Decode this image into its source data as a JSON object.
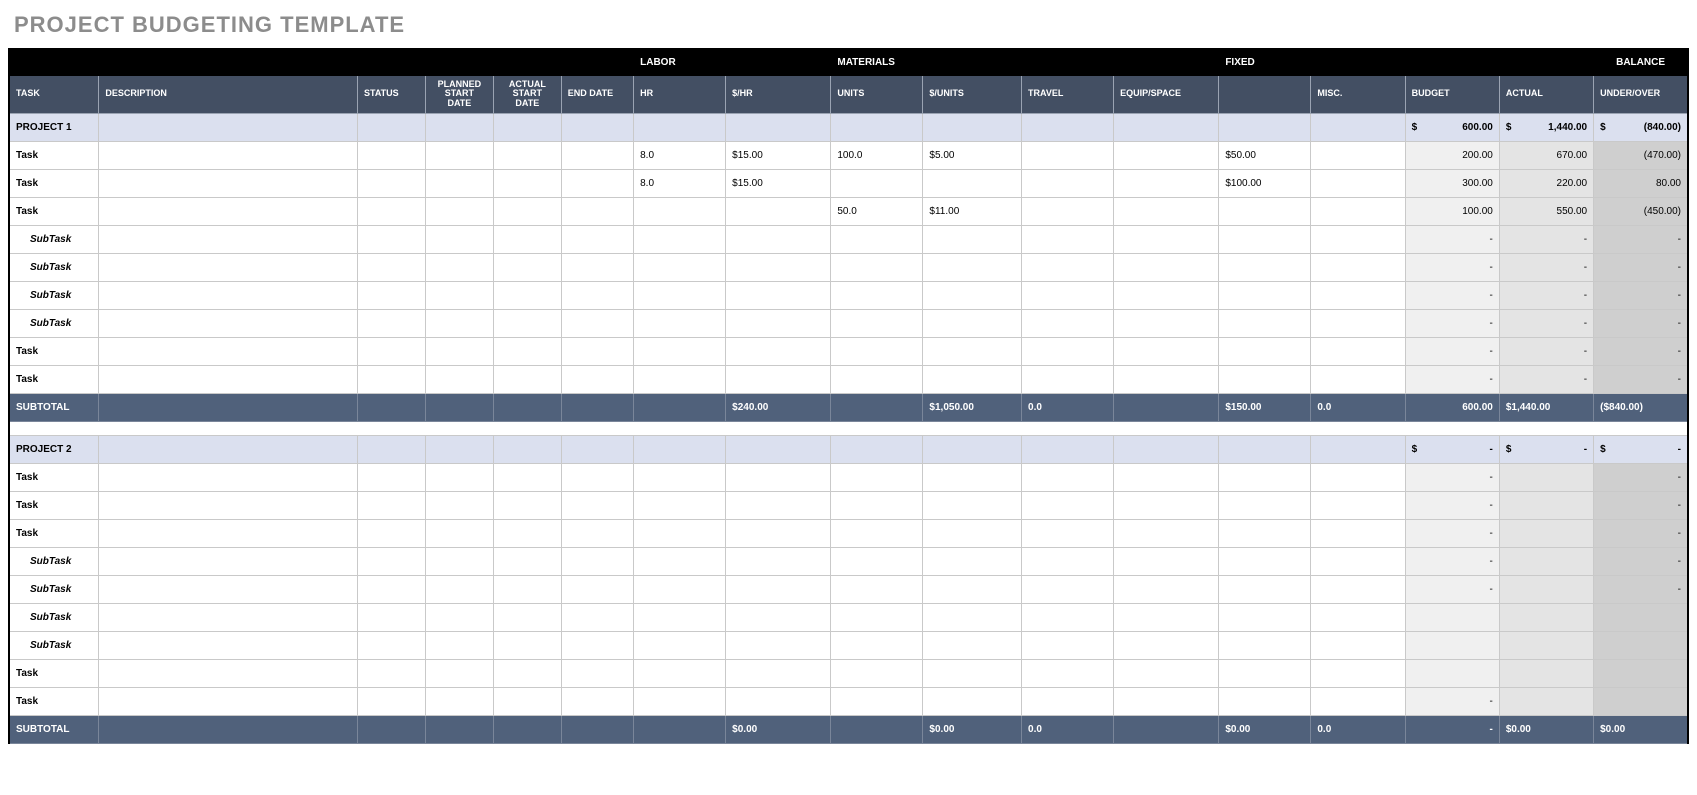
{
  "title": "PROJECT BUDGETING TEMPLATE",
  "categories": {
    "labor": "LABOR",
    "materials": "MATERIALS",
    "fixed": "FIXED",
    "balance": "BALANCE"
  },
  "headers": {
    "task": "TASK",
    "description": "DESCRIPTION",
    "status": "STATUS",
    "planned_start": "PLANNED START DATE",
    "actual_start": "ACTUAL START DATE",
    "end_date": "END DATE",
    "hr": "HR",
    "dollar_hr": "$/HR",
    "units": "UNITS",
    "dollar_units": "$/UNITS",
    "travel": "TRAVEL",
    "equip": "EQUIP/SPACE",
    "fixed_blank": "",
    "misc": "MISC.",
    "budget": "BUDGET",
    "actual": "ACTUAL",
    "under_over": "UNDER/OVER"
  },
  "labels": {
    "subtotal": "SUBTOTAL",
    "task": "Task",
    "subtask": "SubTask"
  },
  "projects": [
    {
      "name": "PROJECT 1",
      "totals": {
        "budget_prefix": "$",
        "budget": "600.00",
        "actual_prefix": "$",
        "actual": "1,440.00",
        "under_prefix": "$",
        "under": "(840.00)"
      },
      "rows": [
        {
          "type": "task",
          "name": "Task",
          "hr": "8.0",
          "dollar_hr": "$15.00",
          "units": "100.0",
          "dollar_units": "$5.00",
          "fixed": "$50.00",
          "budget": "200.00",
          "actual": "670.00",
          "under": "(470.00)"
        },
        {
          "type": "task",
          "name": "Task",
          "hr": "8.0",
          "dollar_hr": "$15.00",
          "units": "",
          "dollar_units": "",
          "fixed": "$100.00",
          "budget": "300.00",
          "actual": "220.00",
          "under": "80.00"
        },
        {
          "type": "task",
          "name": "Task",
          "hr": "",
          "dollar_hr": "",
          "units": "50.0",
          "dollar_units": "$11.00",
          "fixed": "",
          "budget": "100.00",
          "actual": "550.00",
          "under": "(450.00)"
        },
        {
          "type": "subtask",
          "name": "SubTask",
          "budget": "-",
          "actual": "-",
          "under": "-"
        },
        {
          "type": "subtask",
          "name": "SubTask",
          "budget": "-",
          "actual": "-",
          "under": "-"
        },
        {
          "type": "subtask",
          "name": "SubTask",
          "budget": "-",
          "actual": "-",
          "under": "-"
        },
        {
          "type": "subtask",
          "name": "SubTask",
          "budget": "-",
          "actual": "-",
          "under": "-"
        },
        {
          "type": "task",
          "name": "Task",
          "budget": "-",
          "actual": "-",
          "under": "-"
        },
        {
          "type": "task",
          "name": "Task",
          "budget": "-",
          "actual": "-",
          "under": "-"
        }
      ],
      "subtotal": {
        "dollar_hr": "$240.00",
        "dollar_units": "$1,050.00",
        "travel": "0.0",
        "fixed": "$150.00",
        "misc": "0.0",
        "budget": "600.00",
        "actual": "$1,440.00",
        "under": "($840.00)"
      }
    },
    {
      "name": "PROJECT 2",
      "totals": {
        "budget_prefix": "$",
        "budget": "-",
        "actual_prefix": "$",
        "actual": "-",
        "under_prefix": "$",
        "under": "-"
      },
      "rows": [
        {
          "type": "task",
          "name": "Task",
          "budget": "-",
          "actual": "",
          "under": "-"
        },
        {
          "type": "task",
          "name": "Task",
          "budget": "-",
          "actual": "",
          "under": "-"
        },
        {
          "type": "task",
          "name": "Task",
          "budget": "-",
          "actual": "",
          "under": "-"
        },
        {
          "type": "subtask",
          "name": "SubTask",
          "budget": "-",
          "actual": "",
          "under": "-"
        },
        {
          "type": "subtask",
          "name": "SubTask",
          "budget": "-",
          "actual": "",
          "under": "-"
        },
        {
          "type": "subtask",
          "name": "SubTask",
          "budget": "",
          "actual": "",
          "under": ""
        },
        {
          "type": "subtask",
          "name": "SubTask",
          "budget": "",
          "actual": "",
          "under": ""
        },
        {
          "type": "task",
          "name": "Task",
          "budget": "",
          "actual": "",
          "under": ""
        },
        {
          "type": "task",
          "name": "Task",
          "budget": "-",
          "actual": "",
          "under": ""
        }
      ],
      "subtotal": {
        "dollar_hr": "$0.00",
        "dollar_units": "$0.00",
        "travel": "0.0",
        "fixed": "$0.00",
        "misc": "0.0",
        "budget": "-",
        "actual": "$0.00",
        "under": "$0.00"
      }
    }
  ]
}
